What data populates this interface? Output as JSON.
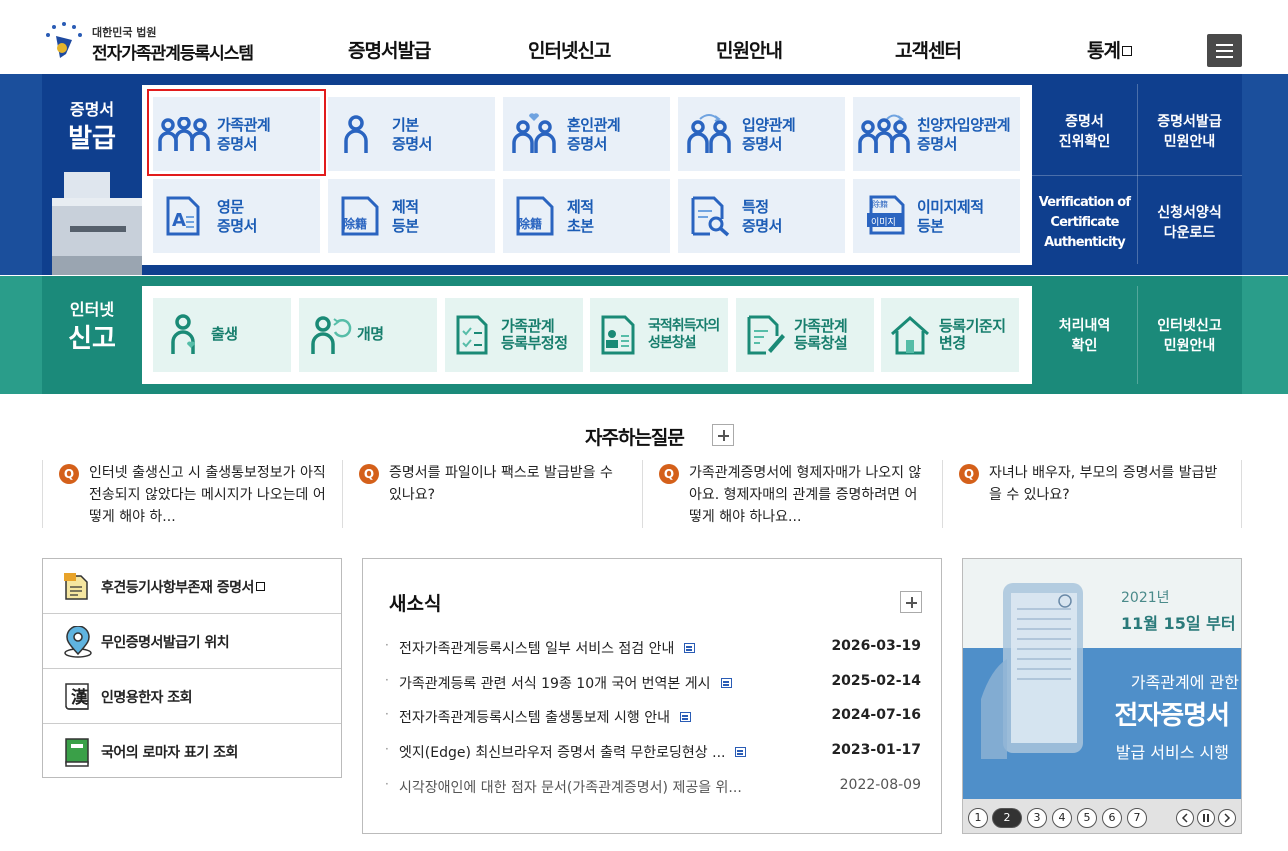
{
  "header": {
    "org": "대한민국 법원",
    "site_title": "전자가족관계등록시스템",
    "nav": [
      "증명서발급",
      "인터넷신고",
      "민원안내",
      "고객센터",
      "통계"
    ]
  },
  "issuance": {
    "band_label_top": "증명서",
    "band_label_bottom": "발급",
    "cards": [
      {
        "label": "가족관계\n증명서",
        "icon": "family-icon"
      },
      {
        "label": "기본\n증명서",
        "icon": "person-icon"
      },
      {
        "label": "혼인관계\n증명서",
        "icon": "couple-heart-icon"
      },
      {
        "label": "입양관계\n증명서",
        "icon": "adoption-icon"
      },
      {
        "label": "친양자입양관계\n증명서",
        "icon": "adoption-family-icon"
      },
      {
        "label": "영문\n증명서",
        "icon": "english-document-icon"
      },
      {
        "label": "제적\n등본",
        "icon": "removed-register-icon"
      },
      {
        "label": "제적\n초본",
        "icon": "removed-register-icon"
      },
      {
        "label": "특정\n증명서",
        "icon": "document-search-icon"
      },
      {
        "label": "이미지제적\n등본",
        "icon": "image-register-icon"
      }
    ],
    "icon_texts": {
      "removed": "除籍",
      "image_top": "除籍",
      "image_bottom": "이미지"
    },
    "side": [
      "증명서\n진위확인",
      "증명서발급\n민원안내",
      "Verification of\nCertificate\nAuthenticity",
      "신청서양식\n다운로드"
    ]
  },
  "report": {
    "band_label_top": "인터넷",
    "band_label_bottom": "신고",
    "cards": [
      {
        "label": "출생",
        "icon": "birth-icon"
      },
      {
        "label": "개명",
        "icon": "rename-icon"
      },
      {
        "label": "가족관계\n등록부정정",
        "icon": "checklist-icon"
      },
      {
        "label": "국적취득자의\n성본창설",
        "icon": "id-card-icon"
      },
      {
        "label": "가족관계\n등록창설",
        "icon": "document-pen-icon"
      },
      {
        "label": "등록기준지\n변경",
        "icon": "house-icon"
      }
    ],
    "side": [
      "처리내역\n확인",
      "인터넷신고\n민원안내"
    ]
  },
  "faq": {
    "title": "자주하는질문",
    "q_mark": "Q",
    "items": [
      "인터넷 출생신고 시 출생통보정보가 아직 전송되지 않았다는 메시지가 나오는데 어떻게 해야 하...",
      "증명서를 파일이나 팩스로 발급받을 수 있나요?",
      "가족관계증명서에 형제자매가 나오지 않아요. 형제자매의 관계를 증명하려면 어떻게 해야 하나요...",
      "자녀나 배우자, 부모의 증명서를 발급받을 수 있나요?"
    ]
  },
  "quick_links": [
    {
      "label": "후견등기사항부존재 증명서",
      "icon": "document-icon"
    },
    {
      "label": "무인증명서발급기 위치",
      "icon": "location-pin-icon"
    },
    {
      "label": "인명용한자 조회",
      "icon": "hanja-book-icon"
    },
    {
      "label": "국어의 로마자 표기 조회",
      "icon": "green-book-icon"
    }
  ],
  "quick_icon_text": "漢",
  "news": {
    "title": "새소식",
    "items": [
      {
        "title": "전자가족관계등록시스템 일부 서비스 점검 안내",
        "date": "2026-03-19"
      },
      {
        "title": "가족관계등록 관련 서식 19종 10개 국어 번역본 게시",
        "date": "2025-02-14"
      },
      {
        "title": "전자가족관계등록시스템 출생통보제 시행 안내",
        "date": "2024-07-16"
      },
      {
        "title": "엣지(Edge) 최신브라우저 증명서 출력 무한로딩현상 ...",
        "date": "2023-01-17"
      },
      {
        "title": "시각장애인에 대한 점자 문서(가족관계증명서) 제공을 위...",
        "date": "2022-08-09"
      }
    ]
  },
  "banner": {
    "year": "2021년",
    "date": "11월 15일 부터",
    "line1": "가족관계에 관한",
    "line2": "전자증명서",
    "line3": "발급 서비스 시행",
    "pages": [
      "1",
      "2",
      "3",
      "4",
      "5",
      "6",
      "7"
    ],
    "current_page": "2"
  }
}
